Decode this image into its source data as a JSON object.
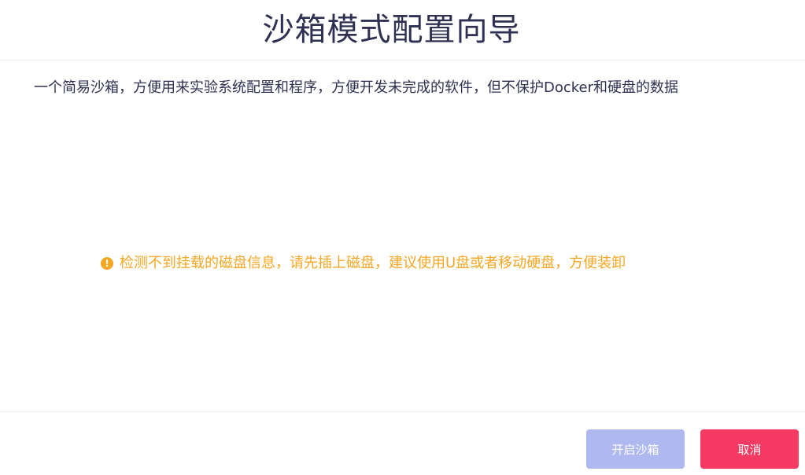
{
  "dialog": {
    "title": "沙箱模式配置向导",
    "description": "一个简易沙箱，方便用来实验系统配置和程序，方便开发未完成的软件，但不保护Docker和硬盘的数据",
    "warning": {
      "icon": "warning-circle-icon",
      "icon_glyph": "!",
      "text": "检测不到挂载的磁盘信息，请先插上磁盘，建议使用U盘或者移动硬盘，方便装卸",
      "color": "#f5a623"
    },
    "buttons": {
      "enable_label": "开启沙箱",
      "enable_state": "disabled",
      "enable_color": "#b0b8f0",
      "cancel_label": "取消",
      "cancel_color": "#f53b63"
    }
  }
}
